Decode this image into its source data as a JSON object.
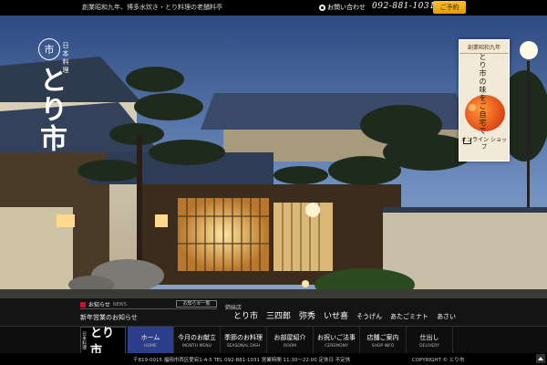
{
  "topbar": {
    "tagline": "創業昭和九年、博多水炊き・とり料理の老舗料亭",
    "contact_label": "お問い合わせ",
    "phone": "092-881-1031",
    "dial_button": "ご予約"
  },
  "logo": {
    "emblem": "市",
    "sub": "日本料理",
    "main": "とり市"
  },
  "promo": {
    "since": "創業昭和九年",
    "headline": "とり市の味をご自宅で",
    "shop_label": "オンライン ショップ"
  },
  "news": {
    "label": "お知らせ",
    "label_en": "NEWS",
    "all_button": "お知らせ一覧",
    "latest": "新年営業のお知らせ"
  },
  "stores": {
    "label": "姉妹店",
    "items": [
      {
        "name": "とり市"
      },
      {
        "name": "三四郎"
      },
      {
        "name": "弥秀"
      },
      {
        "name": "いせ喜"
      },
      {
        "name": "そうげん"
      },
      {
        "name": "あたごミナト"
      },
      {
        "name": "あさい"
      }
    ]
  },
  "nav": {
    "logo_small": "日本料理",
    "logo_big": "とり市",
    "items": [
      {
        "jp": "ホーム",
        "en": "HOME"
      },
      {
        "jp": "今月のお献立",
        "en": "MONTH MENU"
      },
      {
        "jp": "季節のお料理",
        "en": "SEASONAL DISH"
      },
      {
        "jp": "お部屋紹介",
        "en": "ROOM"
      },
      {
        "jp": "お祝いご法事",
        "en": "CEREMONY"
      },
      {
        "jp": "店舗ご案内",
        "en": "SHOP INFO"
      },
      {
        "jp": "仕出し",
        "en": "DELIVERY"
      }
    ]
  },
  "footer": {
    "address": "〒819-0015 福岡市西区愛宕1-4-5 TEL 092-881-1031 営業時間 11:30〜22:00 定休日 不定休",
    "copyright": "COPYRIGHT © とり市"
  },
  "colors": {
    "accent_gold": "#f2b319",
    "nav_active": "#2c3e8a",
    "news_icon": "#c8102e",
    "sky": "#3d5d93"
  }
}
